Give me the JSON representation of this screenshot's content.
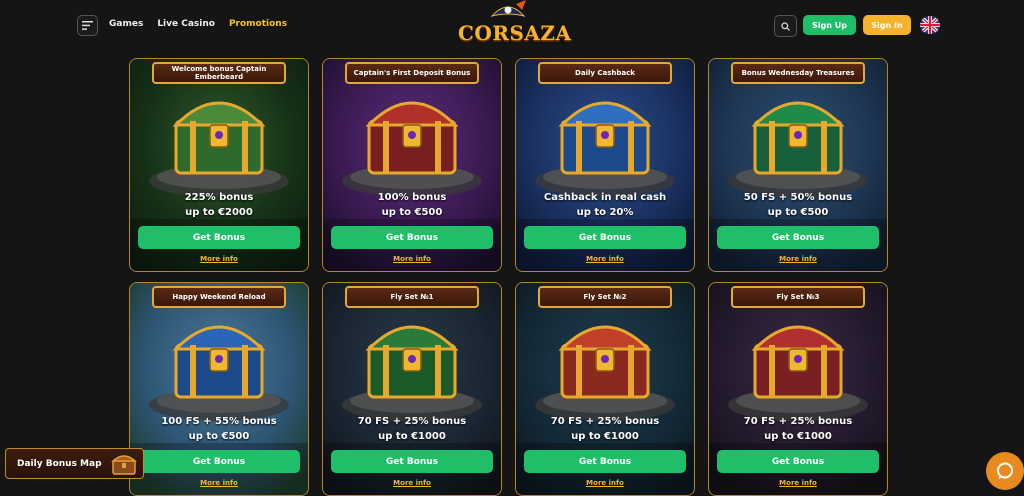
{
  "header": {
    "nav": [
      "Games",
      "Live Casino",
      "Promotions"
    ],
    "active_nav": "Promotions",
    "logo_text": "CORSAZA",
    "signup_label": "Sign Up",
    "signin_label": "Sign In"
  },
  "cards": [
    {
      "title": "Welcome bonus Captain Emberbeard",
      "line1": "225% bonus",
      "line2": "up to €2000",
      "button": "Get Bonus",
      "more": "More info",
      "theme": "green"
    },
    {
      "title": "Captain's First Deposit Bonus",
      "line1": "100% bonus",
      "line2": "up to €500",
      "button": "Get Bonus",
      "more": "More info",
      "theme": "purple"
    },
    {
      "title": "Daily Cashback",
      "line1": "Cashback in real cash",
      "line2": "up to 20%",
      "button": "Get Bonus",
      "more": "More info",
      "theme": "blue"
    },
    {
      "title": "Bonus Wednesday Treasures",
      "line1": "50 FS + 50% bonus",
      "line2": "up to €500",
      "button": "Get Bonus",
      "more": "More info",
      "theme": "teal"
    },
    {
      "title": "Happy Weekend Reload",
      "line1": "100 FS + 55% bonus",
      "line2": "up to €500",
      "button": "Get Bonus",
      "more": "More info",
      "theme": "sky"
    },
    {
      "title": "Fly Set №1",
      "line1": "70 FS + 25% bonus",
      "line2": "up to €1000",
      "button": "Get Bonus",
      "more": "More info",
      "theme": "cave"
    },
    {
      "title": "Fly Set №2",
      "line1": "70 FS + 25% bonus",
      "line2": "up to €1000",
      "button": "Get Bonus",
      "more": "More info",
      "theme": "crystal"
    },
    {
      "title": "Fly Set №3",
      "line1": "70 FS + 25% bonus",
      "line2": "up to €1000",
      "button": "Get Bonus",
      "more": "More info",
      "theme": "dusk"
    }
  ],
  "daily_bonus_map_label": "Daily Bonus Map",
  "colors": {
    "accent_green": "#1fbf6a",
    "accent_gold": "#f5b52a",
    "background": "#151515"
  }
}
